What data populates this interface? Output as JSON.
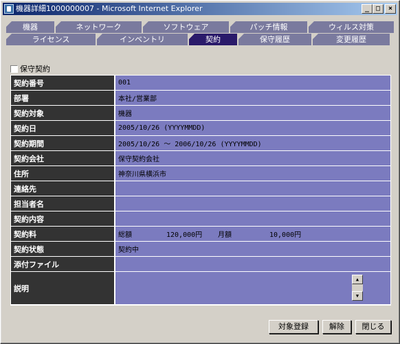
{
  "window": {
    "title": "機器詳細1000000007 - Microsoft Internet Explorer"
  },
  "tabs": {
    "row1": [
      {
        "label": "機器"
      },
      {
        "label": "ネットワーク"
      },
      {
        "label": "ソフトウェア"
      },
      {
        "label": "パッチ情報"
      },
      {
        "label": "ウィルス対策"
      }
    ],
    "row2": [
      {
        "label": "ライセンス"
      },
      {
        "label": "インベントリ"
      },
      {
        "label": "契約",
        "active": true
      },
      {
        "label": "保守履歴"
      },
      {
        "label": "変更履歴"
      }
    ]
  },
  "maintenance_checkbox": {
    "label": "保守契約",
    "checked": false
  },
  "fields": {
    "contract_no": {
      "label": "契約番号",
      "value": "001"
    },
    "department": {
      "label": "部署",
      "value": "本社/営業部"
    },
    "target": {
      "label": "契約対象",
      "value": "機器"
    },
    "date": {
      "label": "契約日",
      "value": "2005/10/26 (YYYYMMDD)"
    },
    "period": {
      "label": "契約期間",
      "value": "2005/10/26 〜 2006/10/26 (YYYYMMDD)"
    },
    "company": {
      "label": "契約会社",
      "value": "保守契約会社"
    },
    "address": {
      "label": "住所",
      "value": "神奈川県横浜市"
    },
    "contact": {
      "label": "連絡先",
      "value": ""
    },
    "person": {
      "label": "担当者名",
      "value": ""
    },
    "content": {
      "label": "契約内容",
      "value": ""
    },
    "fee": {
      "label": "契約料",
      "total_label": "総額",
      "total_value": "120,000円",
      "monthly_label": "月額",
      "monthly_value": "10,000円"
    },
    "status": {
      "label": "契約状態",
      "value": "契約中"
    },
    "attachment": {
      "label": "添付ファイル",
      "value": ""
    },
    "description": {
      "label": "説明",
      "value": ""
    }
  },
  "buttons": {
    "register": "対象登録",
    "release": "解除",
    "close": "閉じる"
  },
  "colors": {
    "label_bg": "#333333",
    "value_bg": "#7b7bbf",
    "tab_bg": "#7a7a9e",
    "tab_active_bg": "#2a1a6a"
  }
}
